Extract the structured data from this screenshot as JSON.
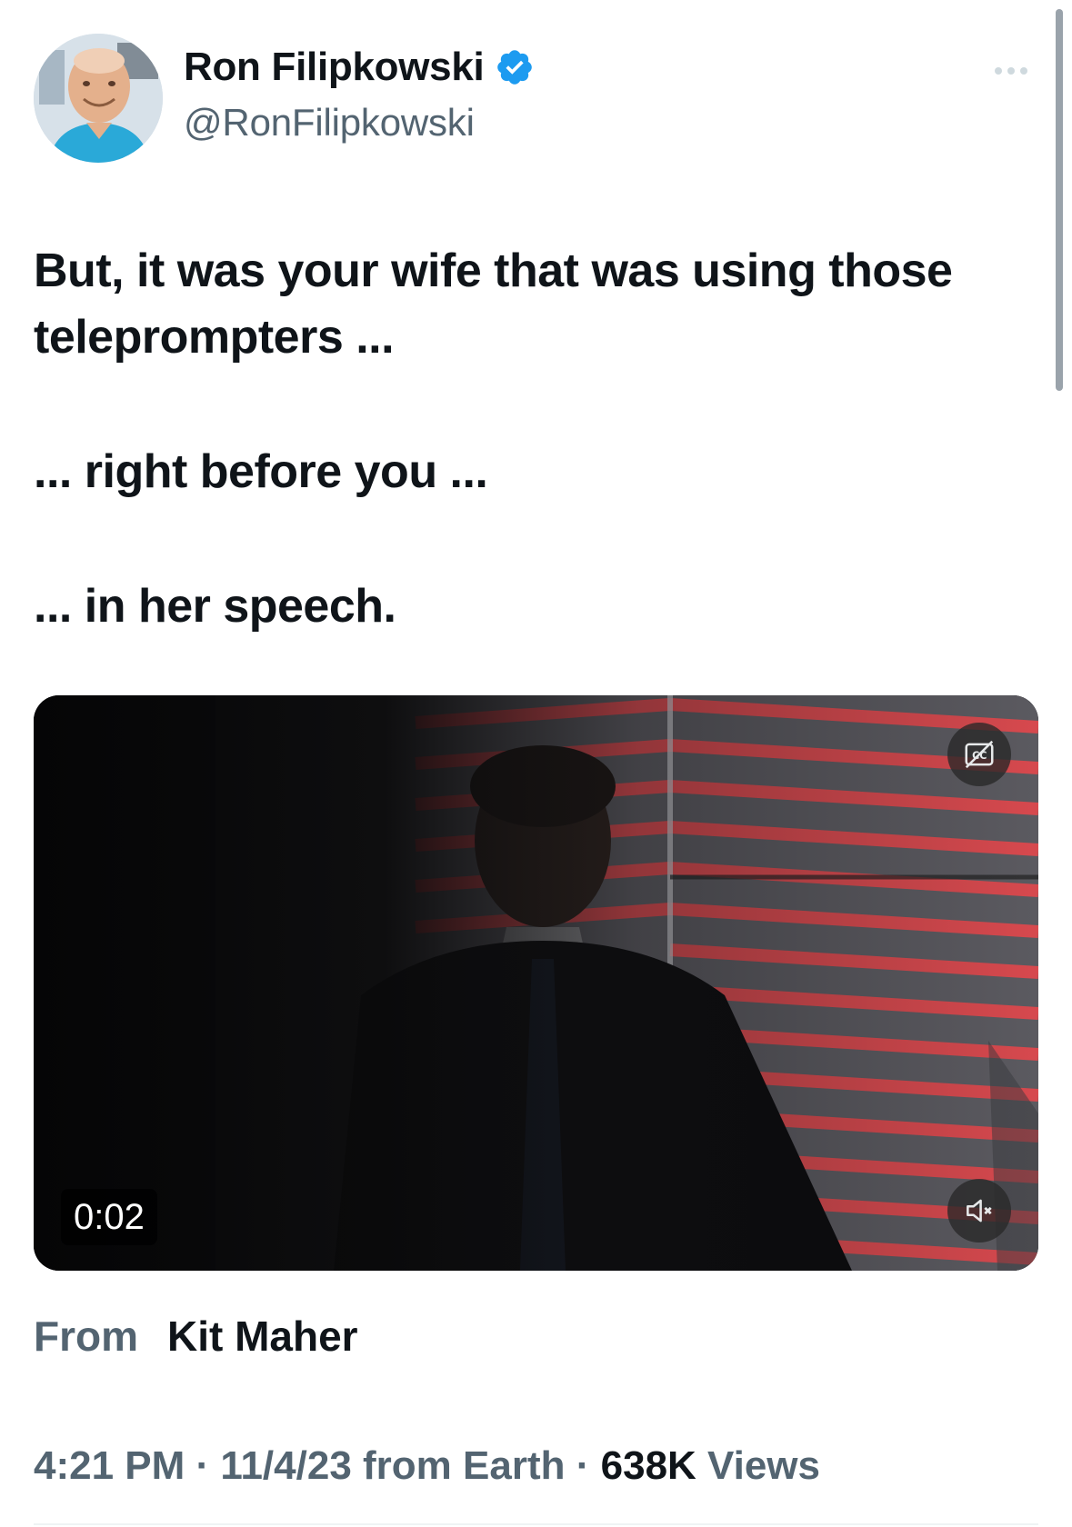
{
  "author": {
    "display_name": "Ron Filipkowski",
    "handle": "@RonFilipkowski",
    "verified": true
  },
  "tweet": {
    "lines": [
      "But, it was your wife that was using those teleprompters ...",
      "... right before you ...",
      "... in her speech."
    ]
  },
  "video": {
    "timestamp": "0:02",
    "captions_icon": "closed-captions-off-icon",
    "mute_icon": "speaker-muted-icon"
  },
  "source": {
    "label": "From",
    "name": "Kit Maher"
  },
  "meta": {
    "time": "4:21 PM",
    "separator": "·",
    "date_location": "11/4/23 from Earth",
    "views_count": "638K",
    "views_label": "Views"
  },
  "colors": {
    "text_primary": "#0f1419",
    "text_secondary": "#536471",
    "verified_blue": "#1d9bf0",
    "video_red_accent": "#e5484d"
  },
  "icons": {
    "more": "more-horizontal-icon",
    "verified": "verified-badge-icon"
  }
}
